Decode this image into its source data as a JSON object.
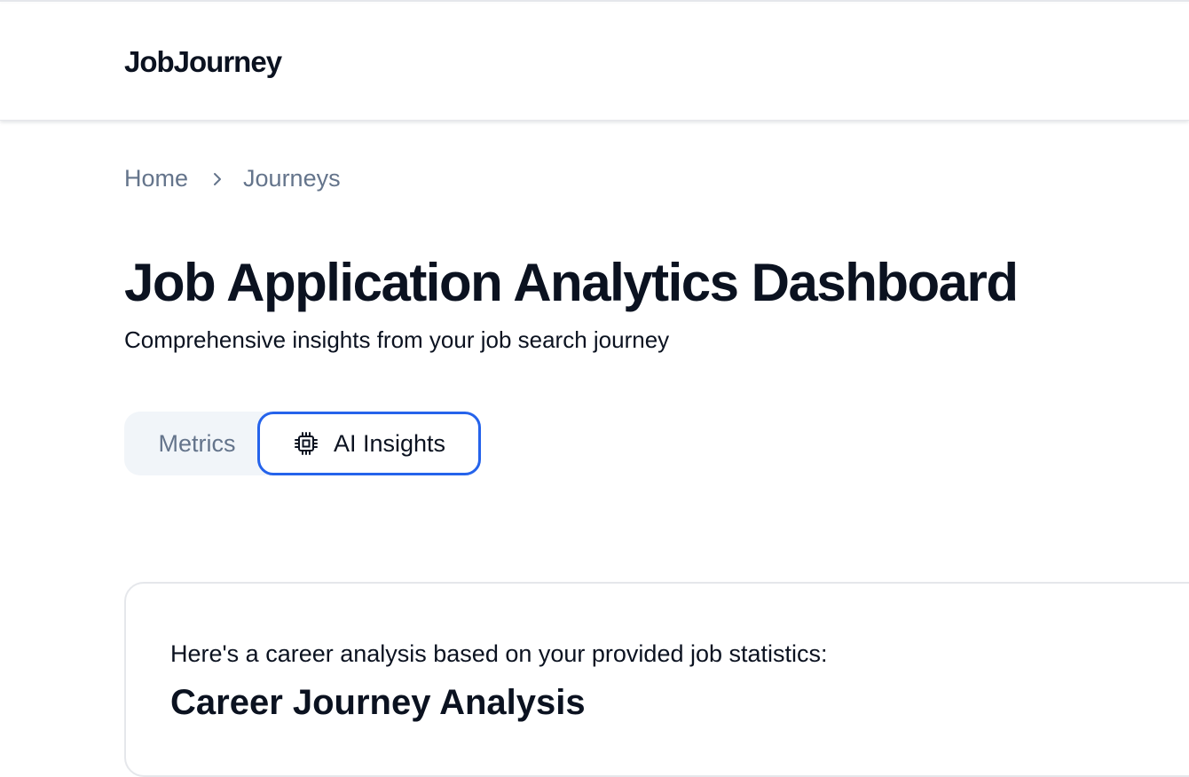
{
  "header": {
    "logo": "JobJourney"
  },
  "breadcrumb": {
    "items": [
      "Home",
      "Journeys"
    ],
    "separator_icon": "chevron-right-icon"
  },
  "page": {
    "title": "Job Application Analytics Dashboard",
    "subtitle": "Comprehensive insights from your job search journey"
  },
  "tabs": {
    "items": [
      {
        "label": "Metrics",
        "active": false
      },
      {
        "label": "AI Insights",
        "active": true,
        "icon": "cpu-chip-icon"
      }
    ]
  },
  "insights": {
    "intro": "Here's a career analysis based on your provided job statistics:",
    "heading": "Career Journey Analysis"
  },
  "colors": {
    "accent": "#2563eb",
    "text": "#0b1220",
    "muted": "#64748b",
    "tab_bg": "#f1f5f9"
  }
}
